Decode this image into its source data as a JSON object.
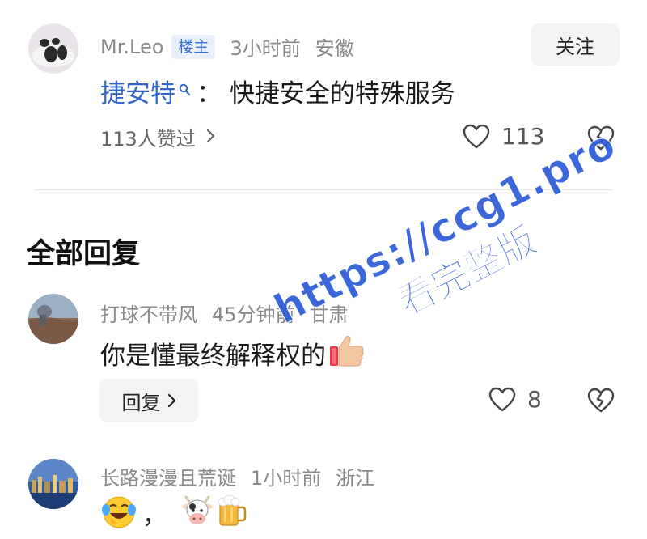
{
  "post": {
    "author": "Mr.Leo",
    "badge": "楼主",
    "time": "3小时前",
    "location": "安徽",
    "follow_label": "关注",
    "content_link": "捷安特",
    "content_rest": "：  快捷安全的特殊服务",
    "liked_by": "113人赞过",
    "like_count": "113"
  },
  "section_title": "全部回复",
  "replies": [
    {
      "author": "打球不带风",
      "time": "45分钟前",
      "location": "甘肃",
      "text": "你是懂最终解释权的",
      "reply_label": "回复",
      "like_count": "8"
    },
    {
      "author": "长路漫漫且荒诞",
      "time": "1小时前",
      "location": "浙江",
      "separator": "，"
    }
  ],
  "watermark": {
    "line1": "https://ccg1.pro",
    "line2": "看完整版"
  },
  "colors": {
    "link": "#2f64c8",
    "badge_bg": "#e9f0fc",
    "button_bg": "#f2f3f5",
    "watermark": "#2b5bd9"
  }
}
